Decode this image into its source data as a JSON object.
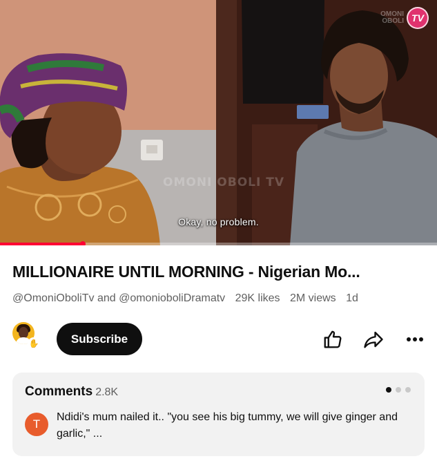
{
  "player": {
    "subtitle": "Okay, no problem.",
    "watermark": "OMONI OBOLI TV",
    "logo_text_top": "OMONI",
    "logo_text_bottom": "OBOLI",
    "logo_badge": "TV",
    "progress_fraction": 0.19,
    "accent_color": "#ff0033"
  },
  "video": {
    "title": "MILLIONAIRE UNTIL MORNING - Nigerian Mo...",
    "channels": "@OmoniOboliTv and @omonioboliDramatv",
    "likes": "29K likes",
    "views": "2M views",
    "age": "1d"
  },
  "actions": {
    "subscribe_label": "Subscribe",
    "avatar_icon": "channel-avatar",
    "like_icon": "thumbs-up-icon",
    "share_icon": "share-arrow-icon",
    "more_icon": "more-dots-icon"
  },
  "comments": {
    "title": "Comments",
    "count": "2.8K",
    "top_comment": {
      "avatar_letter": "T",
      "avatar_color": "#e85c2c",
      "text": "Ndidi's mum nailed it.. \"you see his big tummy, we will give ginger and garlic,\" ..."
    }
  }
}
